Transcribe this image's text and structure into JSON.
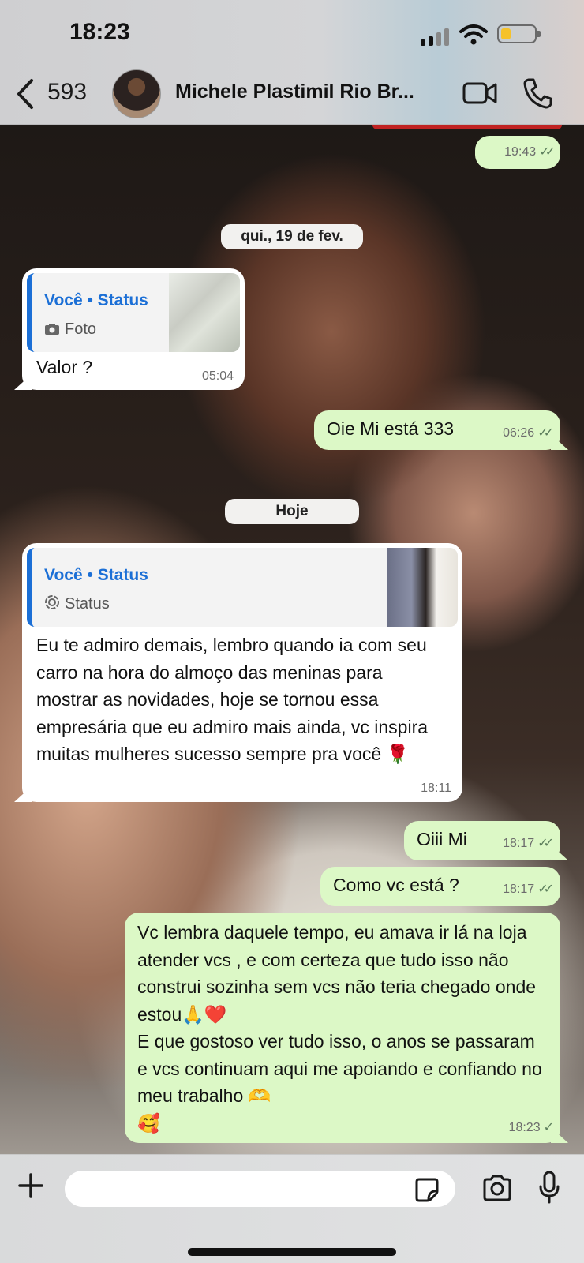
{
  "status_bar": {
    "time": "18:23"
  },
  "header": {
    "unread_count": "593",
    "contact_name": "Michele Plastimil Rio Br..."
  },
  "messages": [
    {
      "side": "out",
      "text": "",
      "time": "19:43",
      "ticks": "✓✓"
    },
    {
      "type": "date",
      "text": "qui., 19 de fev."
    },
    {
      "side": "in",
      "quote": {
        "title": "Você • Status",
        "subtitle": "Foto",
        "icon": "camera-icon"
      },
      "text": "Valor ?",
      "time": "05:04"
    },
    {
      "side": "out",
      "text": "Oie Mi está 333",
      "time": "06:26",
      "ticks": "✓✓"
    },
    {
      "type": "date",
      "text": "Hoje"
    },
    {
      "side": "in",
      "quote": {
        "title": "Você • Status",
        "subtitle": "Status",
        "icon": "status-ring-icon"
      },
      "text": "Eu te admiro demais, lembro quando ia com seu carro na hora do almoço das meninas para mostrar as novidades, hoje se tornou essa empresária que eu admiro mais ainda, vc inspira muitas mulheres sucesso sempre pra você 🌹",
      "time": "18:11"
    },
    {
      "side": "out",
      "text": "Oiii Mi",
      "time": "18:17",
      "ticks": "✓✓"
    },
    {
      "side": "out",
      "text": "Como vc está ?",
      "time": "18:17",
      "ticks": "✓✓"
    },
    {
      "side": "out",
      "text": "Vc lembra daquele tempo, eu amava ir lá na loja atender vcs , e com certeza que tudo isso não construi sozinha sem vcs não teria chegado onde estou🙏❤️\nE que gostoso ver tudo isso, o anos se passaram e vcs continuam aqui me apoiando e confiando no meu trabalho 🫶\n🥰",
      "time": "18:23",
      "ticks": "✓"
    }
  ],
  "input": {
    "placeholder": ""
  },
  "colors": {
    "outgoing_bubble": "#dcf8c6",
    "incoming_bubble": "#ffffff",
    "quote_accent": "#1b6fd6",
    "battery": "#f5c22b"
  },
  "icons": [
    "back-chevron-icon",
    "video-call-icon",
    "phone-icon",
    "plus-icon",
    "sticker-icon",
    "camera-icon",
    "microphone-icon"
  ]
}
